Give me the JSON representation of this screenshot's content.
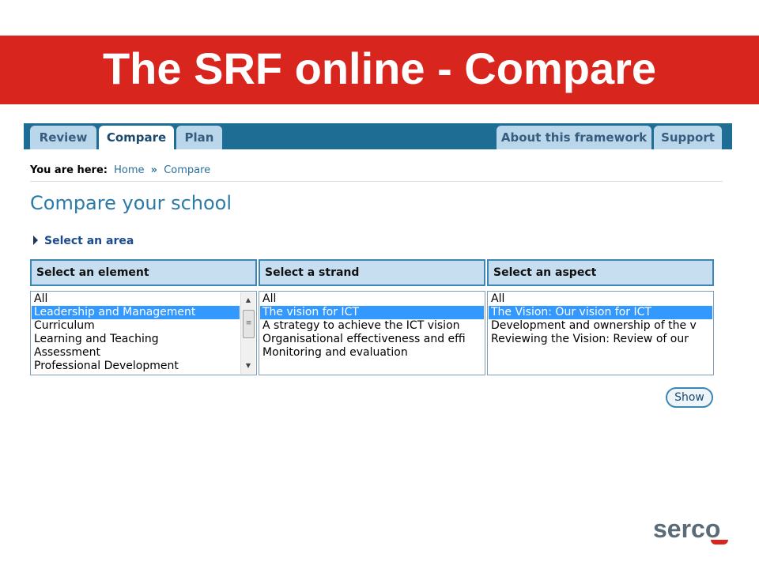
{
  "banner": {
    "title": "The SRF online - Compare"
  },
  "nav": {
    "tabs": [
      {
        "label": "Review",
        "active": false
      },
      {
        "label": "Compare",
        "active": true
      },
      {
        "label": "Plan",
        "active": false
      },
      {
        "label": "About this framework",
        "active": false
      },
      {
        "label": "Support",
        "active": false
      }
    ]
  },
  "breadcrumb": {
    "prefix": "You are here:",
    "home": "Home",
    "separator": "»",
    "current": "Compare"
  },
  "page": {
    "heading": "Compare your school",
    "select_area": "Select an area",
    "show_button": "Show"
  },
  "columns": [
    {
      "header": "Select an element",
      "options": [
        "All",
        "Leadership and Management",
        "Curriculum",
        "Learning and Teaching",
        "Assessment",
        "Professional Development"
      ],
      "selected": "Leadership and Management"
    },
    {
      "header": "Select a strand",
      "options": [
        "All",
        "The vision for ICT",
        "A strategy to achieve the ICT vision",
        "Organisational effectiveness and effi",
        "Monitoring and evaluation"
      ],
      "selected": "The vision for ICT"
    },
    {
      "header": "Select an aspect",
      "options": [
        "All",
        "The Vision: Our vision for ICT",
        "Development and ownership of the v",
        "Reviewing the Vision: Review of our"
      ],
      "selected": "The Vision: Our vision for ICT"
    }
  ],
  "logo": {
    "text": "serco"
  },
  "colors": {
    "banner": "#d8261f",
    "nav_bar": "#1d6d95",
    "tab": "#b9d6ea",
    "selection": "#3399ff",
    "link": "#2b6f9a"
  },
  "icons": [
    "triangle-right-icon",
    "scroll-up-icon",
    "scroll-down-icon"
  ]
}
